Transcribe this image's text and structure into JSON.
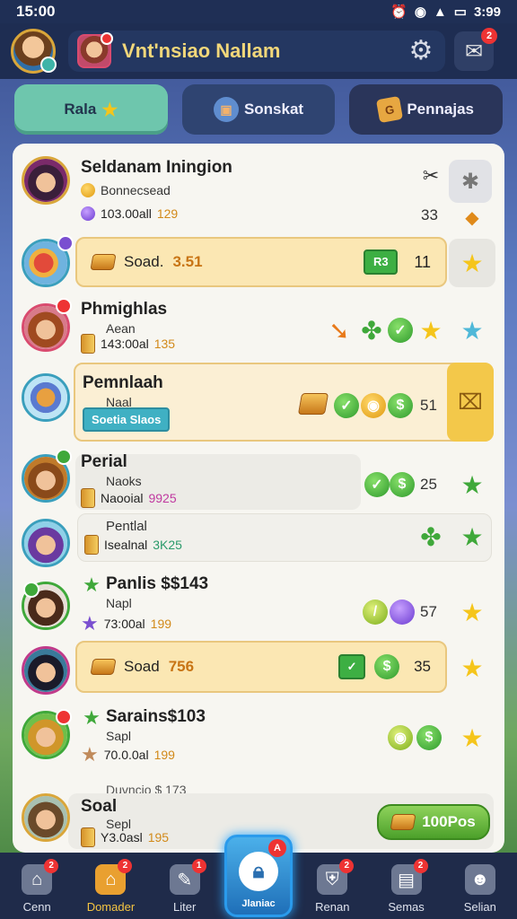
{
  "status": {
    "time_left": "15:00",
    "time_right": "3:99"
  },
  "header": {
    "title": "Vnt'nsiao Nallam",
    "mail_badge": "2"
  },
  "tabs": [
    {
      "label": "Rala",
      "icon": "star-icon"
    },
    {
      "label": "Sonskat",
      "icon": "chest-icon"
    },
    {
      "label": "Pennajas",
      "icon": "tag-icon"
    }
  ],
  "rows": [
    {
      "name": "Seldanam Iningion",
      "sub": "Bonnecsead",
      "meta": "103.00all",
      "meta_val": "129",
      "score": "33"
    },
    {
      "bar_label": "Soad.",
      "bar_value": "3.51",
      "box_label": "R3",
      "score": "11"
    },
    {
      "name": "Phmighlas",
      "sub": "Aean",
      "meta": "143:00al",
      "meta_val": "135"
    },
    {
      "name": "Pemnlaah",
      "sub": "Naal",
      "button": "Soetia Slaos",
      "score": "51"
    },
    {
      "name": "Perial",
      "sub": "Naoks",
      "meta": "Naooial",
      "meta_val": "9925",
      "score": "25"
    },
    {
      "name": "Pentlal",
      "meta": "Isealnal",
      "meta_val": "3K25"
    },
    {
      "name": "Panlis $$143",
      "sub": "Napl",
      "meta": "73:00al",
      "meta_val": "199",
      "score": "57"
    },
    {
      "bar_label": "Soad",
      "bar_value": "756",
      "score": "35"
    },
    {
      "name": "Sarains$103",
      "sub": "Sapl",
      "meta": "70.0.0al",
      "meta_val": "199"
    },
    {
      "name": "Soal",
      "name_over": "Duvncio $ 173",
      "sub": "Sepl",
      "meta": "Y3.0asl",
      "meta_val": "195",
      "button": "100Pos"
    }
  ],
  "nav": [
    {
      "label": "Cenn",
      "badge": "2"
    },
    {
      "label": "Domader",
      "badge": "2"
    },
    {
      "label": "Liter",
      "badge": "1"
    },
    {
      "label": "Jlaniac",
      "badge": "A"
    },
    {
      "label": "Renan",
      "badge": "2"
    },
    {
      "label": "Semas",
      "badge": "2"
    },
    {
      "label": "Selian"
    }
  ],
  "colors": {
    "accent_gold": "#f5c542",
    "panel": "#f7f6f1",
    "tab_active": "#6ec6ad"
  }
}
